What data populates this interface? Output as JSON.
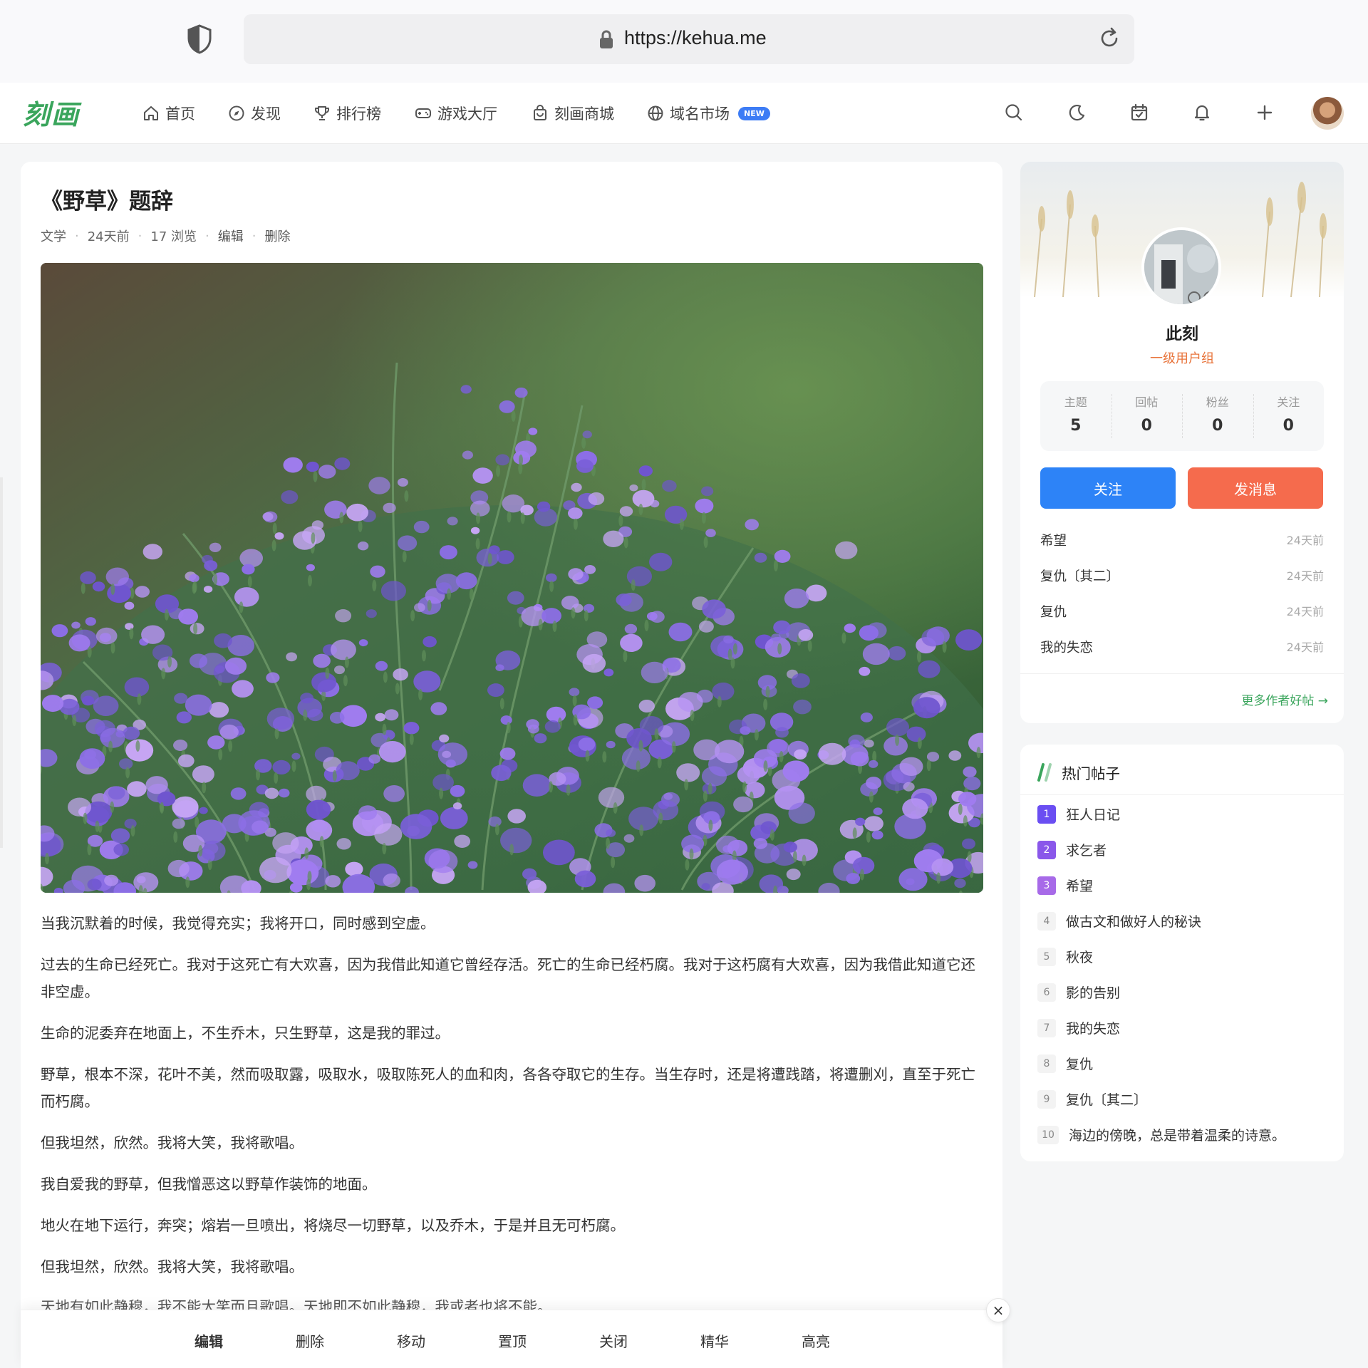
{
  "browser": {
    "url": "https://kehua.me"
  },
  "nav": {
    "logo": "刻画",
    "items": [
      {
        "label": "首页",
        "icon": "home-icon"
      },
      {
        "label": "发现",
        "icon": "compass-icon"
      },
      {
        "label": "排行榜",
        "icon": "trophy-icon"
      },
      {
        "label": "游戏大厅",
        "icon": "gamepad-icon"
      },
      {
        "label": "刻画商城",
        "icon": "shopping-bag-icon"
      },
      {
        "label": "域名市场",
        "icon": "globe-icon"
      }
    ],
    "new_badge": "NEW"
  },
  "article": {
    "title": "《野草》题辞",
    "category": "文学",
    "time": "24天前",
    "views": "17 浏览",
    "edit": "编辑",
    "delete": "删除",
    "paragraphs": [
      "当我沉默着的时候，我觉得充实；我将开口，同时感到空虚。",
      "过去的生命已经死亡。我对于这死亡有大欢喜，因为我借此知道它曾经存活。死亡的生命已经朽腐。我对于这朽腐有大欢喜，因为我借此知道它还非空虚。",
      "生命的泥委弃在地面上，不生乔木，只生野草，这是我的罪过。",
      "野草，根本不深，花叶不美，然而吸取露，吸取水，吸取陈死人的血和肉，各各夺取它的生存。当生存时，还是将遭践踏，将遭删刈，直至于死亡而朽腐。",
      "但我坦然，欣然。我将大笑，我将歌唱。",
      "我自爱我的野草，但我憎恶这以野草作装饰的地面。",
      "地火在地下运行，奔突；熔岩一旦喷出，将烧尽一切野草，以及乔木，于是并且无可朽腐。",
      "但我坦然，欣然。我将大笑，我将歌唱。"
    ],
    "cut_line": "天地有如此静穆，我不能大笑而且歌唱。天地即不如此静穆，我或者也将不能。"
  },
  "toolbar": {
    "buttons": [
      "编辑",
      "删除",
      "移动",
      "置顶",
      "关闭",
      "精华",
      "高亮"
    ],
    "close": "×"
  },
  "author": {
    "name": "此刻",
    "group": "一级用户组",
    "stats": [
      {
        "label": "主题",
        "value": "5"
      },
      {
        "label": "回帖",
        "value": "0"
      },
      {
        "label": "粉丝",
        "value": "0"
      },
      {
        "label": "关注",
        "value": "0"
      }
    ],
    "follow_label": "关注",
    "message_label": "发消息",
    "posts": [
      {
        "title": "希望",
        "time": "24天前"
      },
      {
        "title": "复仇〔其二〕",
        "time": "24天前"
      },
      {
        "title": "复仇",
        "time": "24天前"
      },
      {
        "title": "我的失恋",
        "time": "24天前"
      }
    ],
    "more_label": "更多作者好帖 →"
  },
  "hot": {
    "title": "热门帖子",
    "items": [
      {
        "rank": "1",
        "title": "狂人日记"
      },
      {
        "rank": "2",
        "title": "求乞者"
      },
      {
        "rank": "3",
        "title": "希望"
      },
      {
        "rank": "4",
        "title": "做古文和做好人的秘诀"
      },
      {
        "rank": "5",
        "title": "秋夜"
      },
      {
        "rank": "6",
        "title": "影的告别"
      },
      {
        "rank": "7",
        "title": "我的失恋"
      },
      {
        "rank": "8",
        "title": "复仇"
      },
      {
        "rank": "9",
        "title": "复仇〔其二〕"
      },
      {
        "rank": "10",
        "title": "海边的傍晚，总是带着温柔的诗意。"
      }
    ]
  },
  "colors": {
    "brand_green": "#3aa55c",
    "follow_blue": "#2d83f7",
    "message_orange": "#f56b4d",
    "group_orange": "#e8743b",
    "rank_purple": "#6a4ef2"
  }
}
